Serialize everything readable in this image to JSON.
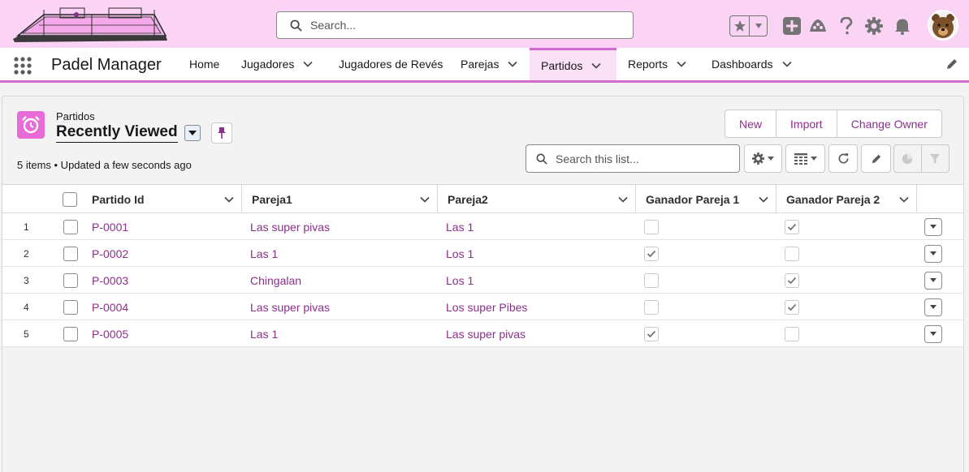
{
  "header": {
    "search_placeholder": "Search..."
  },
  "nav": {
    "app_name": "Padel Manager",
    "items": [
      {
        "label": "Home",
        "has_menu": false
      },
      {
        "label": "Jugadores",
        "has_menu": true
      },
      {
        "label": "Jugadores de Revés",
        "has_menu": false
      },
      {
        "label": "Parejas",
        "has_menu": true
      },
      {
        "label": "Partidos",
        "has_menu": true,
        "active": true
      },
      {
        "label": "Reports",
        "has_menu": true
      },
      {
        "label": "Dashboards",
        "has_menu": true
      }
    ]
  },
  "list_view": {
    "object_label": "Partidos",
    "view_name": "Recently Viewed",
    "status": "5 items • Updated a few seconds ago",
    "buttons": {
      "new": "New",
      "import": "Import",
      "change_owner": "Change Owner"
    },
    "search_placeholder": "Search this list..."
  },
  "table": {
    "columns": [
      "Partido Id",
      "Pareja1",
      "Pareja2",
      "Ganador Pareja 1",
      "Ganador Pareja 2"
    ],
    "rows": [
      {
        "num": "1",
        "id": "P-0001",
        "pareja1": "Las super pivas",
        "pareja2": "Las 1",
        "g1": false,
        "g2": true
      },
      {
        "num": "2",
        "id": "P-0002",
        "pareja1": "Las 1",
        "pareja2": "Los 1",
        "g1": true,
        "g2": false
      },
      {
        "num": "3",
        "id": "P-0003",
        "pareja1": "Chingalan",
        "pareja2": "Los 1",
        "g1": false,
        "g2": true
      },
      {
        "num": "4",
        "id": "P-0004",
        "pareja1": "Las super pivas",
        "pareja2": "Los super Pibes",
        "g1": false,
        "g2": true
      },
      {
        "num": "5",
        "id": "P-0005",
        "pareja1": "Las 1",
        "pareja2": "Las super pivas",
        "g1": true,
        "g2": false
      }
    ]
  },
  "colors": {
    "header_bg": "#fbd3f4",
    "accent": "#d26bd0",
    "link": "#8b2f8a",
    "object_icon": "#e86bd7"
  },
  "icons": [
    "padel-court-logo",
    "search-icon",
    "star-icon",
    "plus-icon",
    "trailhead-icon",
    "help-icon",
    "gear-icon",
    "bell-icon",
    "bear-avatar",
    "app-launcher-icon",
    "edit-icon",
    "alarm-clock-icon",
    "pin-icon",
    "refresh-icon",
    "table-icon",
    "chart-icon",
    "filter-icon"
  ]
}
